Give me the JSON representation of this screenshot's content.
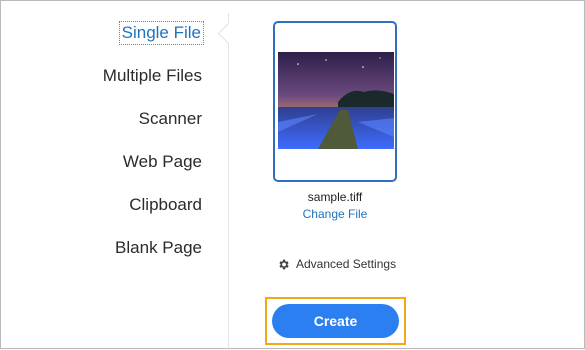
{
  "nav": {
    "items": [
      {
        "label": "Single File",
        "active": true
      },
      {
        "label": "Multiple Files",
        "active": false
      },
      {
        "label": "Scanner",
        "active": false
      },
      {
        "label": "Web Page",
        "active": false
      },
      {
        "label": "Clipboard",
        "active": false
      },
      {
        "label": "Blank Page",
        "active": false
      }
    ]
  },
  "file": {
    "name": "sample.tiff",
    "change_label": "Change File"
  },
  "advanced_label": "Advanced Settings",
  "create_label": "Create",
  "icons": {
    "advanced": "gear-icon"
  },
  "colors": {
    "accent": "#1e73be",
    "button": "#2c7ff0",
    "highlight": "#f0a81d"
  }
}
